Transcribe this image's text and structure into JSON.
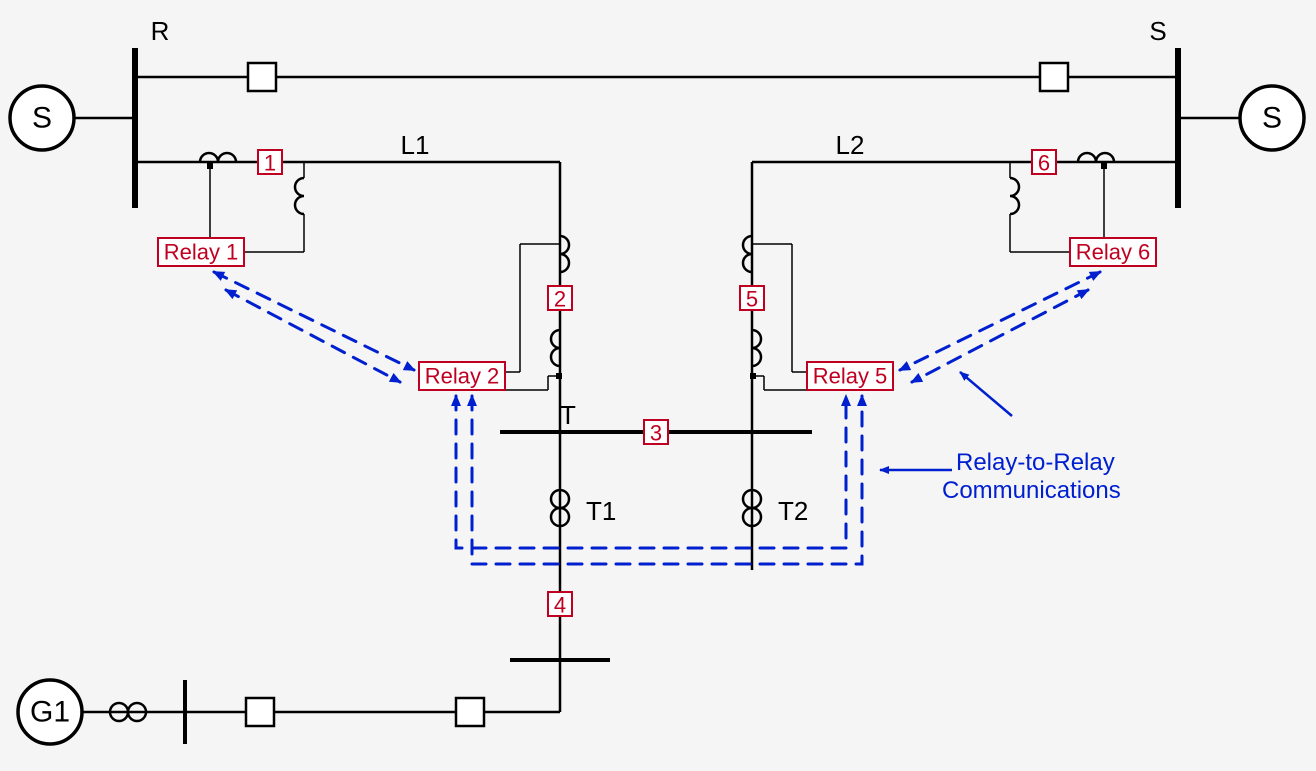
{
  "buses": {
    "R": "R",
    "S": "S",
    "T": "T"
  },
  "lines": {
    "L1": "L1",
    "L2": "L2"
  },
  "sources": {
    "left": "S",
    "right": "S",
    "gen": "G1"
  },
  "breakers": {
    "b1": "1",
    "b2": "2",
    "b3": "3",
    "b4": "4",
    "b5": "5",
    "b6": "6"
  },
  "relays": {
    "r1": "Relay 1",
    "r2": "Relay 2",
    "r5": "Relay 5",
    "r6": "Relay 6"
  },
  "transformers": {
    "T1": "T1",
    "T2": "T2"
  },
  "annotation": {
    "line1": "Relay-to-Relay",
    "line2": "Communications"
  }
}
